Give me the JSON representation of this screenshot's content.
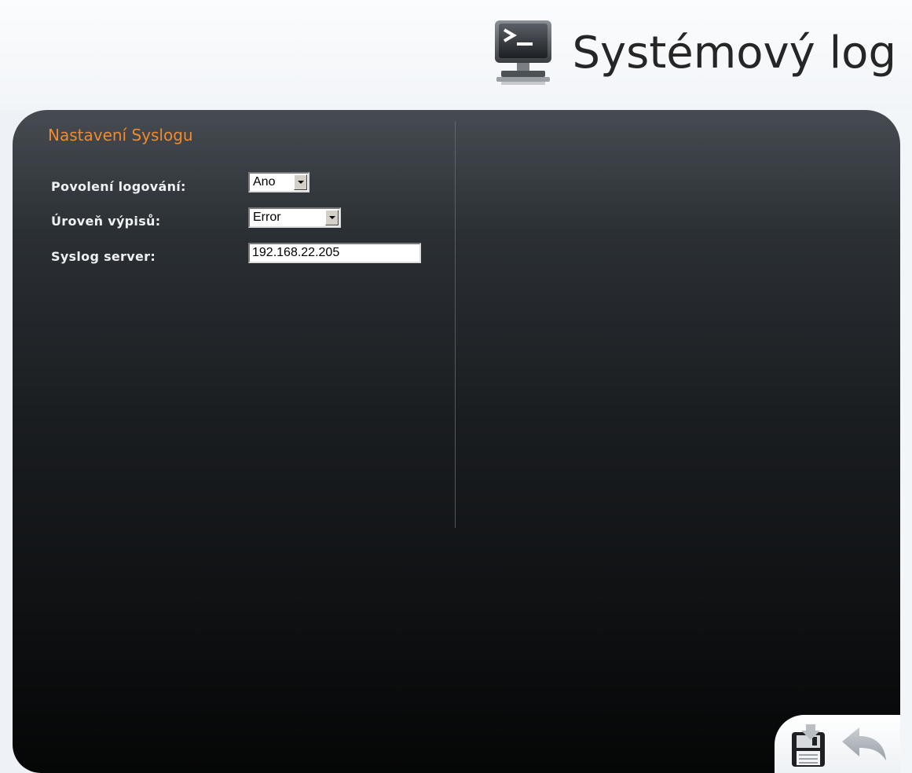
{
  "header": {
    "title": "Systémový log",
    "icon": "terminal-monitor-icon"
  },
  "section": {
    "title": "Nastavení Syslogu"
  },
  "form": {
    "logging_enabled": {
      "label": "Povolení logování:",
      "value": "Ano"
    },
    "log_level": {
      "label": "Úroveň výpisů:",
      "value": "Error"
    },
    "syslog_server": {
      "label": "Syslog server:",
      "value": "192.168.22.205"
    }
  },
  "actions": {
    "save_icon": "save-icon",
    "back_icon": "back-arrow-icon"
  },
  "colors": {
    "section_title": "#f08a2c",
    "panel_top": "#3c4248",
    "panel_bottom": "#050606"
  }
}
